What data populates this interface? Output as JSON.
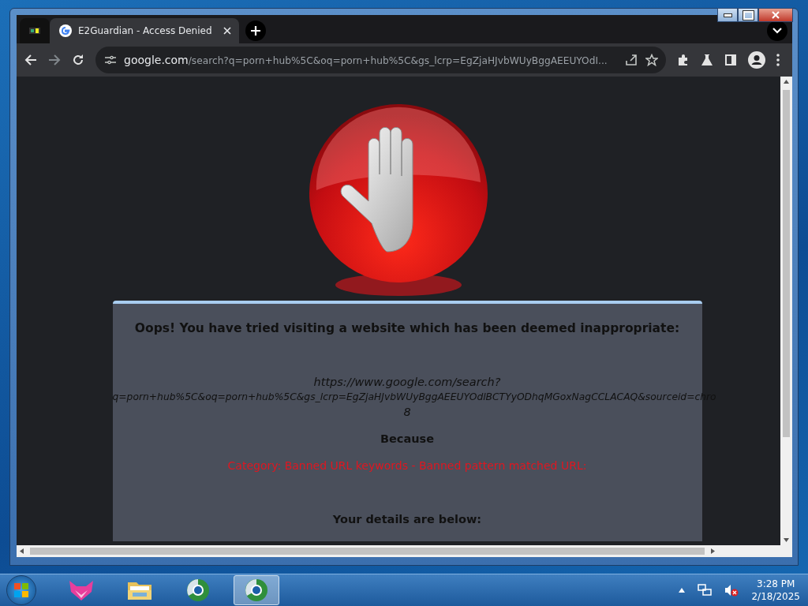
{
  "tabs": [
    {
      "kind": "pinned",
      "selected": false
    },
    {
      "kind": "page",
      "title": "E2Guardian - Access Denied",
      "selected": true
    }
  ],
  "nav": [
    {
      "kind": "back",
      "disabled": false
    },
    {
      "kind": "forward",
      "disabled": true
    },
    {
      "kind": "reload",
      "disabled": false
    }
  ],
  "address": {
    "host": "google.com",
    "path": "/search?q=porn+hub%5C&oq=porn+hub%5C&gs_lcrp=EgZjaHJvbWUyBggAEEUYOdI..."
  },
  "page": {
    "heading": "Oops! You have tried visiting a website which has been deemed inappropriate:",
    "url_lines": [
      "https://www.google.com/search?",
      "q=porn+hub%5C&oq=porn+hub%5C&gs_lcrp=EgZjaHJvbWUyBggAEEUYOdlBCTYyODhqMGoxNagCCLACAQ&sourceid=chro",
      "8"
    ],
    "because": "Because",
    "reason": "Category: Banned URL keywords - Banned pattern matched URL:",
    "details": "Your details are below:"
  },
  "taskbar": {
    "apps": [
      {
        "kind": "fox",
        "selected": false
      },
      {
        "kind": "folder",
        "selected": false
      },
      {
        "kind": "globe",
        "selected": false
      },
      {
        "kind": "globe",
        "selected": true
      }
    ],
    "time": "3:28 PM",
    "date": "2/18/2025"
  }
}
